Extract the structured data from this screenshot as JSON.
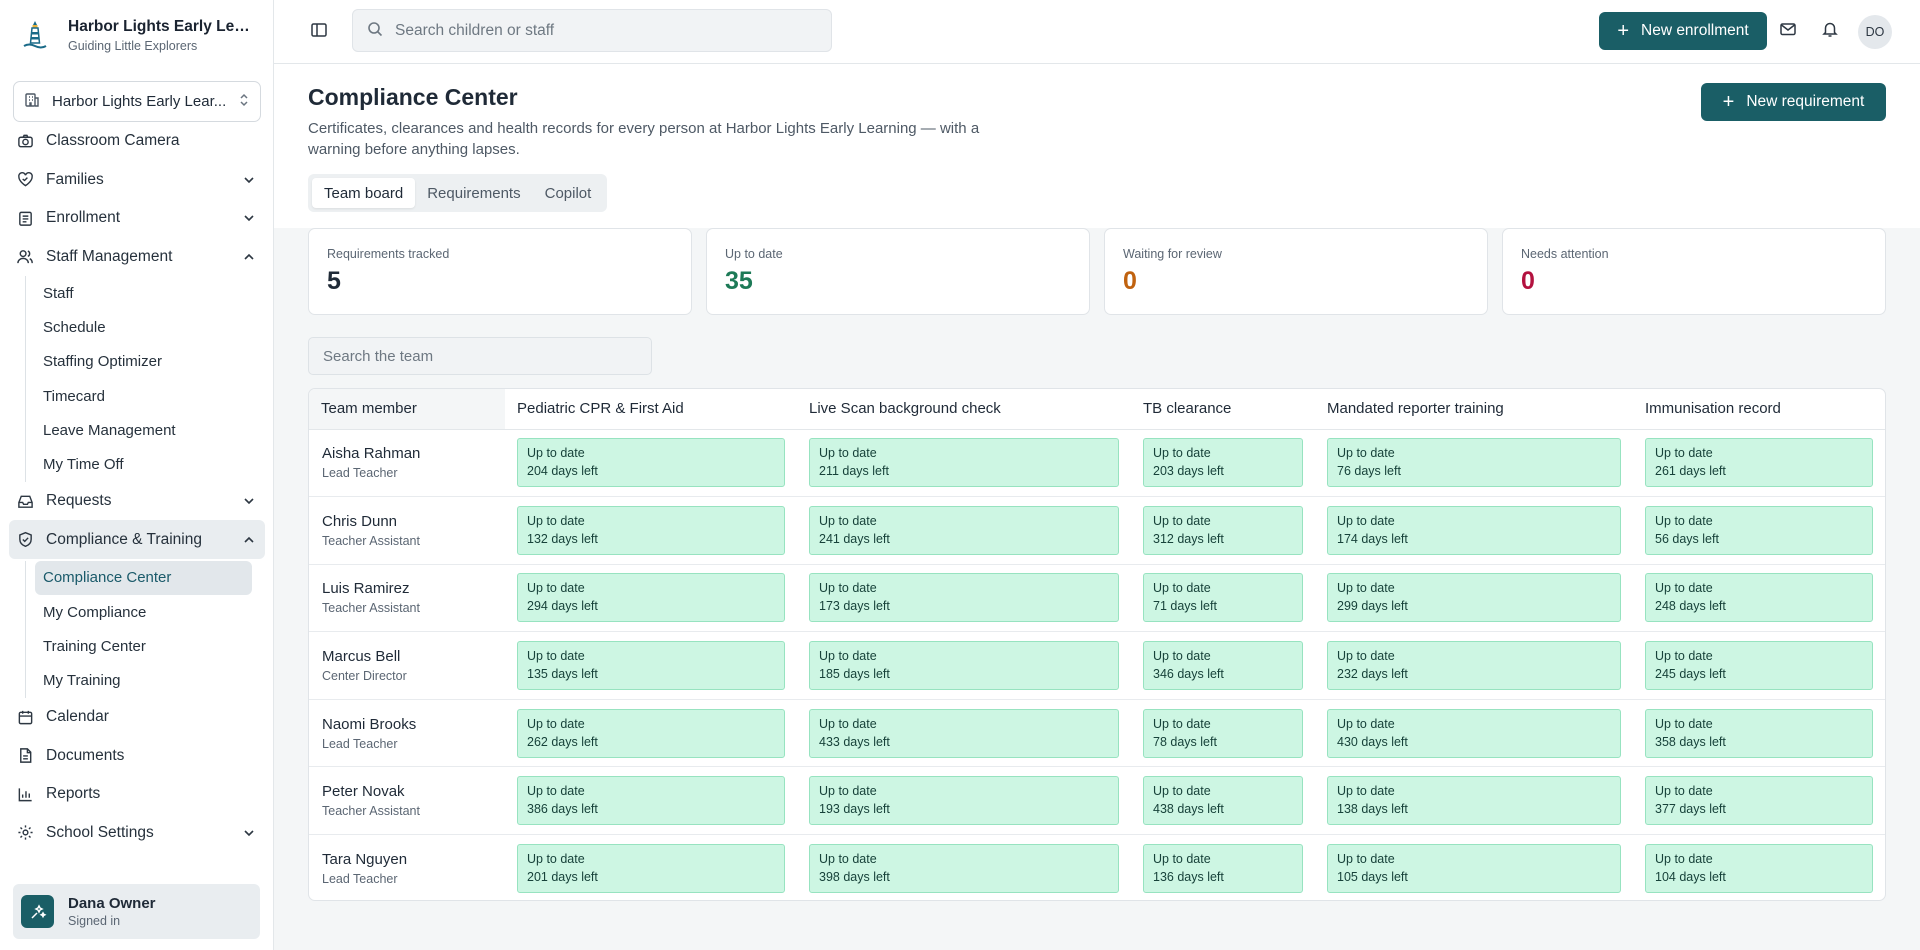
{
  "brand": {
    "title": "Harbor Lights Early Learn...",
    "subtitle": "Guiding Little Explorers"
  },
  "school_select": {
    "name": "Harbor Lights Early Lear..."
  },
  "nav": {
    "classroom_camera": "Classroom Camera",
    "families": "Families",
    "enrollment": "Enrollment",
    "staff_management": "Staff Management",
    "staff_sub": [
      "Staff",
      "Schedule",
      "Staffing Optimizer",
      "Timecard",
      "Leave Management",
      "My Time Off"
    ],
    "requests": "Requests",
    "compliance": "Compliance & Training",
    "compliance_sub": [
      "Compliance Center",
      "My Compliance",
      "Training Center",
      "My Training"
    ],
    "calendar": "Calendar",
    "documents": "Documents",
    "reports": "Reports",
    "school_settings": "School Settings"
  },
  "user": {
    "name": "Dana Owner",
    "status": "Signed in",
    "initials": "DO"
  },
  "topbar": {
    "search_placeholder": "Search children or staff",
    "new_enrollment": "New enrollment"
  },
  "page": {
    "title": "Compliance Center",
    "description": "Certificates, clearances and health records for every person at Harbor Lights Early Learning — with a warning before anything lapses.",
    "new_requirement": "New requirement",
    "tabs": [
      "Team board",
      "Requirements",
      "Copilot"
    ]
  },
  "stats": [
    {
      "label": "Requirements tracked",
      "value": "5",
      "color": "#1f2a37"
    },
    {
      "label": "Up to date",
      "value": "35",
      "color": "#1d7a57"
    },
    {
      "label": "Waiting for review",
      "value": "0",
      "color": "#c0620f"
    },
    {
      "label": "Needs attention",
      "value": "0",
      "color": "#b3123f"
    }
  ],
  "team_search_placeholder": "Search the team",
  "table": {
    "headers": [
      "Team member",
      "Pediatric CPR & First Aid",
      "Live Scan background check",
      "TB clearance",
      "Mandated reporter training",
      "Immunisation record"
    ],
    "status_text": "Up to date",
    "rows": [
      {
        "name": "Aisha Rahman",
        "role": "Lead Teacher",
        "days": [
          "204 days left",
          "211 days left",
          "203 days left",
          "76 days left",
          "261 days left"
        ]
      },
      {
        "name": "Chris Dunn",
        "role": "Teacher Assistant",
        "days": [
          "132 days left",
          "241 days left",
          "312 days left",
          "174 days left",
          "56 days left"
        ]
      },
      {
        "name": "Luis Ramirez",
        "role": "Teacher Assistant",
        "days": [
          "294 days left",
          "173 days left",
          "71 days left",
          "299 days left",
          "248 days left"
        ]
      },
      {
        "name": "Marcus Bell",
        "role": "Center Director",
        "days": [
          "135 days left",
          "185 days left",
          "346 days left",
          "232 days left",
          "245 days left"
        ]
      },
      {
        "name": "Naomi Brooks",
        "role": "Lead Teacher",
        "days": [
          "262 days left",
          "433 days left",
          "78 days left",
          "430 days left",
          "358 days left"
        ]
      },
      {
        "name": "Peter Novak",
        "role": "Teacher Assistant",
        "days": [
          "386 days left",
          "193 days left",
          "438 days left",
          "138 days left",
          "377 days left"
        ]
      },
      {
        "name": "Tara Nguyen",
        "role": "Lead Teacher",
        "days": [
          "201 days left",
          "398 days left",
          "136 days left",
          "105 days left",
          "104 days left"
        ]
      }
    ]
  }
}
